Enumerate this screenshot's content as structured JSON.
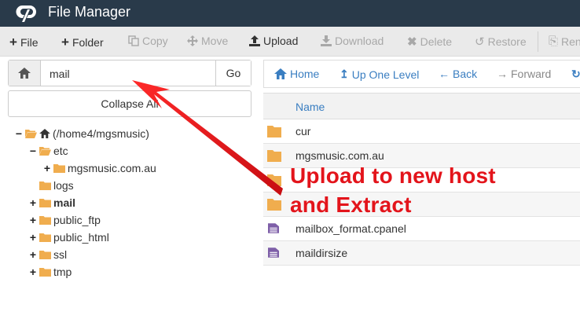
{
  "app": {
    "title": "File Manager"
  },
  "toolbar": {
    "file": "File",
    "folder": "Folder",
    "copy": "Copy",
    "move": "Move",
    "upload": "Upload",
    "download": "Download",
    "delete": "Delete",
    "restore": "Restore",
    "rename": "Ren"
  },
  "path": {
    "value": "mail",
    "go_label": "Go"
  },
  "sidebar": {
    "collapse_label": "Collapse All",
    "tree": [
      {
        "label": "(/home4/mgsmusic)",
        "toggle": "−"
      },
      {
        "label": "etc",
        "toggle": "−"
      },
      {
        "label": "mgsmusic.com.au",
        "toggle": "+"
      },
      {
        "label": "logs",
        "toggle": ""
      },
      {
        "label": "mail",
        "toggle": "+"
      },
      {
        "label": "public_ftp",
        "toggle": "+"
      },
      {
        "label": "public_html",
        "toggle": "+"
      },
      {
        "label": "ssl",
        "toggle": "+"
      },
      {
        "label": "tmp",
        "toggle": "+"
      }
    ]
  },
  "nav": {
    "home": "Home",
    "up_one_level": "Up One Level",
    "back": "Back",
    "forward": "Forward"
  },
  "table": {
    "header_name": "Name",
    "rows": [
      {
        "name": "cur",
        "type": "folder"
      },
      {
        "name": "mgsmusic.com.au",
        "type": "folder"
      },
      {
        "name": "",
        "type": "folder"
      },
      {
        "name": "",
        "type": "folder"
      },
      {
        "name": "mailbox_format.cpanel",
        "type": "file"
      },
      {
        "name": "maildirsize",
        "type": "file"
      }
    ]
  },
  "annotation": {
    "line1": "Upload to new host",
    "line2": "and Extract"
  },
  "colors": {
    "titlebar": "#293a4a",
    "link": "#3a7ec1",
    "folder": "#f0ad4e",
    "file": "#7e5fa8",
    "annotation": "#e3141b"
  }
}
